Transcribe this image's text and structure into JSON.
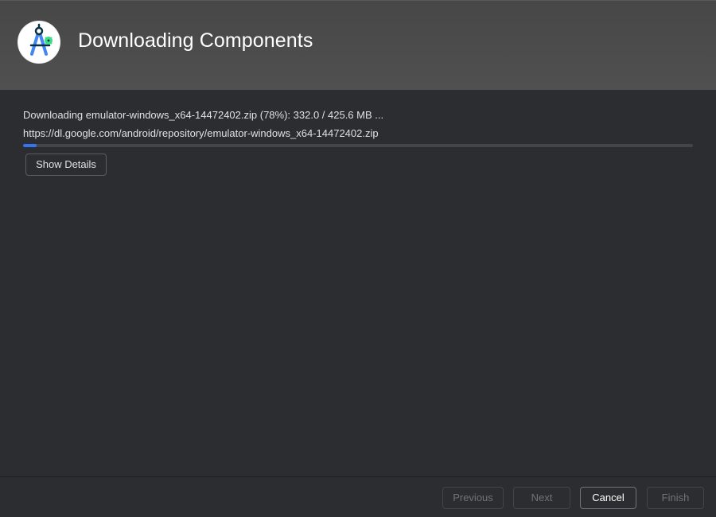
{
  "header": {
    "title": "Downloading Components",
    "logo_icon": "android-studio-icon"
  },
  "content": {
    "status_text": "Downloading emulator-windows_x64-14472402.zip (78%): 332.0 / 425.6 MB ...",
    "url_text": "https://dl.google.com/android/repository/emulator-windows_x64-14472402.zip",
    "progress_fraction": 0.02,
    "show_details_label": "Show Details"
  },
  "footer": {
    "previous_label": "Previous",
    "next_label": "Next",
    "cancel_label": "Cancel",
    "finish_label": "Finish"
  },
  "colors": {
    "accent": "#3574f0",
    "background": "#2b2d30",
    "header": "#4a4a4a"
  }
}
